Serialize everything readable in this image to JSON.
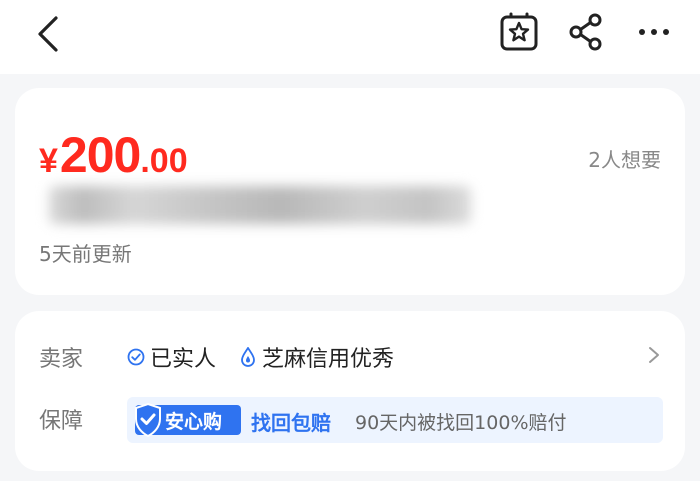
{
  "topbar": {
    "icons": {
      "back": "chevron-left-icon",
      "favorite": "star-box-icon",
      "share": "share-icon",
      "more": "more-dots-icon"
    }
  },
  "product": {
    "currency": "¥",
    "price_int": "200",
    "price_dec": ".00",
    "want_count": "2人想要",
    "updated": "5天前更新"
  },
  "seller": {
    "label": "卖家",
    "verified": "已实人",
    "credit": "芝麻信用优秀"
  },
  "guarantee": {
    "label": "保障",
    "badge": "安心购",
    "main": "找回包赔",
    "desc": "90天内被找回100%赔付"
  },
  "colors": {
    "price": "#ff2a1f",
    "accent": "#2f73f0",
    "background": "#f5f6f8"
  }
}
